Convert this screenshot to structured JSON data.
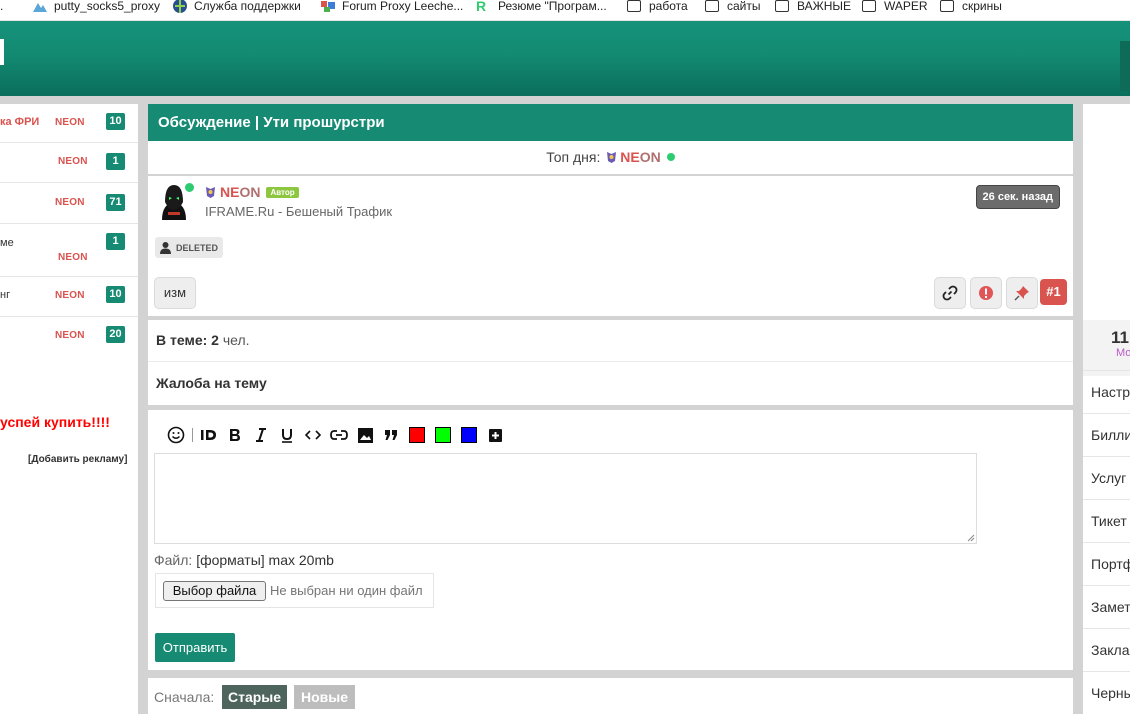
{
  "bookmarks": [
    {
      "label": "putty_socks5_proxy",
      "icon": "mountain-icon"
    },
    {
      "label": "Служба поддержки",
      "icon": "globe-icon"
    },
    {
      "label": "Forum Proxy Leeche...",
      "icon": "forum-icon"
    },
    {
      "label": "Резюме \"Програм...",
      "icon": "r-logo-icon"
    },
    {
      "label": "работа",
      "icon": "folder-icon"
    },
    {
      "label": "сайты",
      "icon": "folder-icon"
    },
    {
      "label": "ВАЖНЫЕ",
      "icon": "folder-icon"
    },
    {
      "label": "WAPER",
      "icon": "folder-icon"
    },
    {
      "label": "скрины",
      "icon": "folder-icon"
    }
  ],
  "left": {
    "items": [
      {
        "title": "ка ФРИ",
        "user": "NEON",
        "count": "10"
      },
      {
        "title": "",
        "user": "NEON",
        "count": "1"
      },
      {
        "title": "",
        "user": "NEON",
        "count": "71"
      },
      {
        "title": "ме",
        "user": "NEON",
        "count": "1"
      },
      {
        "title": "нг",
        "user": "NEON",
        "count": "10"
      },
      {
        "title": "",
        "user": "NEON",
        "count": "20"
      }
    ],
    "promo": "успей купить!!!!",
    "add_ad": "[Добавить рекламу]"
  },
  "topic": {
    "title": "Обсуждение | Ути прошурстри",
    "top_day_label": "Топ дня:",
    "top_day_user_a": "NE",
    "top_day_user_b": "ON"
  },
  "post": {
    "nick_a": "NE",
    "nick_b": "ON",
    "author_badge": "Автор",
    "subtitle": "IFRAME.Ru - Бешеный Трафик",
    "time": "26 сек. назад",
    "deleted": "DELETED",
    "edit": "изм",
    "number": "#1"
  },
  "info": {
    "in_topic_label": "В теме:",
    "in_topic_count": "2",
    "in_topic_unit": "чел.",
    "complaint": "Жалоба на тему"
  },
  "editor": {
    "file_label": "Файл:",
    "file_formats": "[форматы] max 20mb",
    "choose_file": "Выбор файла",
    "no_file": "Не выбран ни один файл",
    "submit": "Отправить",
    "colors": {
      "red": "#ff0000",
      "green": "#00ff00",
      "blue": "#0000ff"
    }
  },
  "sort": {
    "label": "Сначала:",
    "old": "Старые",
    "new": "Новые"
  },
  "right": {
    "count": "11",
    "count_sub": "Мо",
    "items": [
      "Настр",
      "Билли",
      "Услуг",
      "Тикет",
      "Портф",
      "Замет",
      "Закла",
      "Черны"
    ]
  },
  "colors": {
    "accent": "#168a72",
    "nick": "#d9534f",
    "online": "#2ecc71"
  }
}
